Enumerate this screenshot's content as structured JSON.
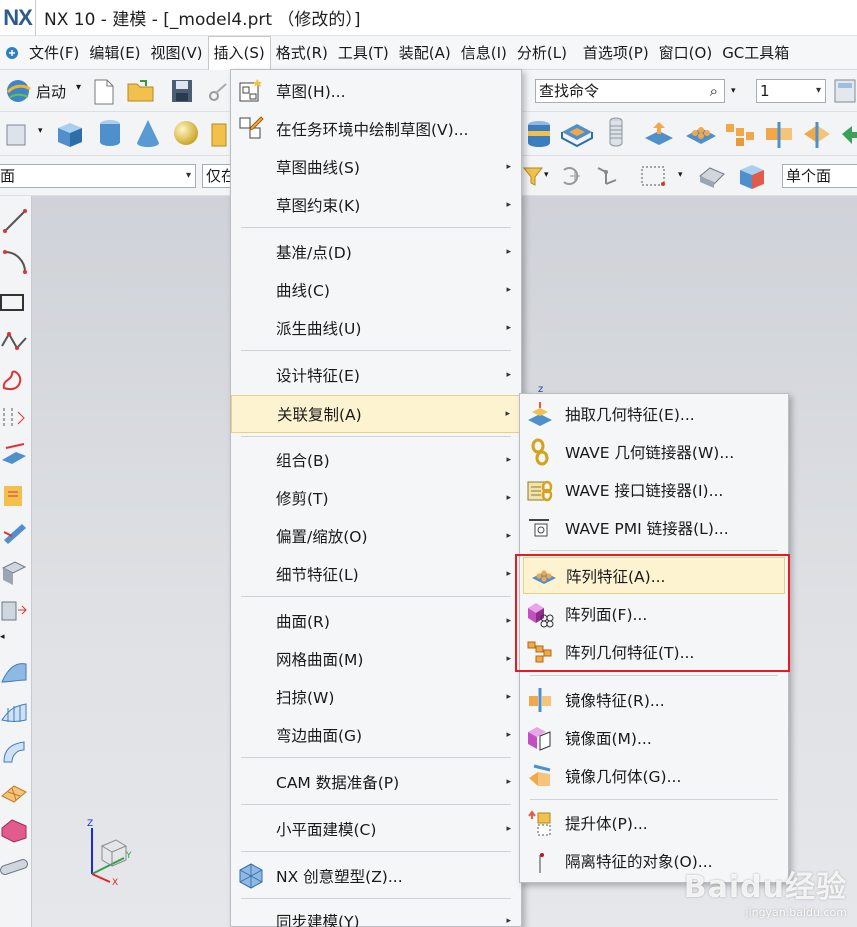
{
  "window": {
    "logo": "NX",
    "title": "NX 10 - 建模 - [_model4.prt （修改的）]"
  },
  "menubar": [
    {
      "label": "文件(F)"
    },
    {
      "label": "编辑(E)"
    },
    {
      "label": "视图(V)"
    },
    {
      "label": "插入(S)",
      "active": true
    },
    {
      "label": "格式(R)"
    },
    {
      "label": "工具(T)"
    },
    {
      "label": "装配(A)"
    },
    {
      "label": "信息(I)"
    },
    {
      "label": "分析(L)"
    },
    {
      "label": "首选项(P)"
    },
    {
      "label": "窗口(O)"
    },
    {
      "label": "GC工具箱"
    }
  ],
  "toolbar": {
    "start_label": "启动",
    "search_placeholder": "查找命令",
    "count_value": "1",
    "filter_value": "面",
    "scope_value": "仅在",
    "select_value": "单个面"
  },
  "insert_menu": {
    "items": [
      {
        "label": "草图(H)...",
        "icon": "sketch-icon",
        "submenu": false
      },
      {
        "label": "在任务环境中绘制草图(V)...",
        "icon": "task-sketch-icon",
        "submenu": false
      },
      {
        "label": "草图曲线(S)",
        "submenu": true
      },
      {
        "label": "草图约束(K)",
        "submenu": true
      },
      {
        "label": "基准/点(D)",
        "submenu": true
      },
      {
        "label": "曲线(C)",
        "submenu": true
      },
      {
        "label": "派生曲线(U)",
        "submenu": true
      },
      {
        "label": "设计特征(E)",
        "submenu": true
      },
      {
        "label": "关联复制(A)",
        "submenu": true,
        "highlighted": true
      },
      {
        "label": "组合(B)",
        "submenu": true
      },
      {
        "label": "修剪(T)",
        "submenu": true
      },
      {
        "label": "偏置/缩放(O)",
        "submenu": true
      },
      {
        "label": "细节特征(L)",
        "submenu": true
      },
      {
        "label": "曲面(R)",
        "submenu": true
      },
      {
        "label": "网格曲面(M)",
        "submenu": true
      },
      {
        "label": "扫掠(W)",
        "submenu": true
      },
      {
        "label": "弯边曲面(G)",
        "submenu": true
      },
      {
        "label": "CAM 数据准备(P)",
        "submenu": true
      },
      {
        "label": "小平面建模(C)",
        "submenu": true
      },
      {
        "label": "NX 创意塑型(Z)...",
        "icon": "nx-realize-shape-icon",
        "submenu": false
      },
      {
        "label": "同步建模(Y)",
        "submenu": true
      }
    ]
  },
  "associative_copy_menu": {
    "items": [
      {
        "label": "抽取几何特征(E)...",
        "icon": "extract-geometry-icon"
      },
      {
        "label": "WAVE 几何链接器(W)...",
        "icon": "wave-geometry-linker-icon"
      },
      {
        "label": "WAVE 接口链接器(I)...",
        "icon": "wave-interface-linker-icon"
      },
      {
        "label": "WAVE PMI 链接器(L)...",
        "icon": "wave-pmi-linker-icon"
      },
      {
        "label": "阵列特征(A)...",
        "icon": "pattern-feature-icon",
        "highlighted": true
      },
      {
        "label": "阵列面(F)...",
        "icon": "pattern-face-icon"
      },
      {
        "label": "阵列几何特征(T)...",
        "icon": "pattern-geometry-icon"
      },
      {
        "label": "镜像特征(R)...",
        "icon": "mirror-feature-icon"
      },
      {
        "label": "镜像面(M)...",
        "icon": "mirror-face-icon"
      },
      {
        "label": "镜像几何体(G)...",
        "icon": "mirror-geometry-icon"
      },
      {
        "label": "提升体(P)...",
        "icon": "promote-body-icon"
      },
      {
        "label": "隔离特征的对象(O)...",
        "icon": "isolate-feature-icon"
      }
    ]
  },
  "watermark": {
    "brand": "Baidu经验",
    "url": "jingyan.baidu.com"
  },
  "colors": {
    "highlight": "#fdf3d0",
    "annotation_box": "#e31b23",
    "menu_bg": "#f5f6f8"
  }
}
